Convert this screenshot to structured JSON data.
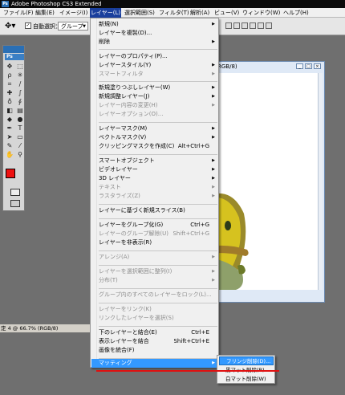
{
  "window": {
    "title": "Adobe Photoshop CS3 Extended"
  },
  "menubar": {
    "items": [
      "ファイル(F)",
      "編集(E)",
      "イメージ(I)",
      "レイヤー(L)",
      "選択範囲(S)",
      "フィルタ(T)",
      "解析(A)",
      "ビュー(V)",
      "ウィンドウ(W)",
      "ヘルプ(H)"
    ],
    "active_index": 3
  },
  "options_bar": {
    "auto_select_label": "自動選択：",
    "auto_select_value": "グループ",
    "auto_select_checked": true
  },
  "toolbox": {
    "logo": "Ps",
    "foreground_color": "#ee1111",
    "background_color": "#ffffff",
    "tools": [
      "move-tool-icon",
      "marquee-tool-icon",
      "lasso-tool-icon",
      "magic-wand-tool-icon",
      "crop-tool-icon",
      "slice-tool-icon",
      "healing-brush-tool-icon",
      "brush-tool-icon",
      "clone-stamp-tool-icon",
      "history-brush-tool-icon",
      "eraser-tool-icon",
      "gradient-tool-icon",
      "blur-tool-icon",
      "dodge-tool-icon",
      "pen-tool-icon",
      "type-tool-icon",
      "path-selection-tool-icon",
      "shape-tool-icon",
      "notes-tool-icon",
      "eyedropper-tool-icon",
      "hand-tool-icon",
      "zoom-tool-icon"
    ]
  },
  "document": {
    "title_fragment": "RGB/8)",
    "left_status": "定 4 @ 66.7% (RGB/8)"
  },
  "layer_menu": {
    "items": [
      {
        "label": "新規(N)",
        "shortcut": "",
        "submenu": true,
        "disabled": false
      },
      {
        "label": "レイヤーを複製(D)...",
        "shortcut": "",
        "submenu": false,
        "disabled": false
      },
      {
        "label": "削除",
        "shortcut": "",
        "submenu": true,
        "disabled": false
      },
      {
        "separator": true
      },
      {
        "label": "レイヤーのプロパティ(P)...",
        "shortcut": "",
        "submenu": false,
        "disabled": false
      },
      {
        "label": "レイヤースタイル(Y)",
        "shortcut": "",
        "submenu": true,
        "disabled": false
      },
      {
        "label": "スマートフィルタ",
        "shortcut": "",
        "submenu": true,
        "disabled": true
      },
      {
        "separator": true
      },
      {
        "label": "新規塗りつぶしレイヤー(W)",
        "shortcut": "",
        "submenu": true,
        "disabled": false
      },
      {
        "label": "新規調整レイヤー(J)",
        "shortcut": "",
        "submenu": true,
        "disabled": false
      },
      {
        "label": "レイヤー内容の変更(H)",
        "shortcut": "",
        "submenu": true,
        "disabled": true
      },
      {
        "label": "レイヤーオプション(O)...",
        "shortcut": "",
        "submenu": false,
        "disabled": true
      },
      {
        "separator": true
      },
      {
        "label": "レイヤーマスク(M)",
        "shortcut": "",
        "submenu": true,
        "disabled": false
      },
      {
        "label": "ベクトルマスク(V)",
        "shortcut": "",
        "submenu": true,
        "disabled": false
      },
      {
        "label": "クリッピングマスクを作成(C)",
        "shortcut": "Alt+Ctrl+G",
        "submenu": false,
        "disabled": false
      },
      {
        "separator": true
      },
      {
        "label": "スマートオブジェクト",
        "shortcut": "",
        "submenu": true,
        "disabled": false
      },
      {
        "label": "ビデオレイヤー",
        "shortcut": "",
        "submenu": true,
        "disabled": false
      },
      {
        "label": "3D レイヤー",
        "shortcut": "",
        "submenu": true,
        "disabled": false
      },
      {
        "label": "テキスト",
        "shortcut": "",
        "submenu": true,
        "disabled": true
      },
      {
        "label": "ラスタライズ(Z)",
        "shortcut": "",
        "submenu": true,
        "disabled": true
      },
      {
        "separator": true
      },
      {
        "label": "レイヤーに基づく新規スライス(B)",
        "shortcut": "",
        "submenu": false,
        "disabled": false
      },
      {
        "separator": true
      },
      {
        "label": "レイヤーをグループ化(G)",
        "shortcut": "Ctrl+G",
        "submenu": false,
        "disabled": false
      },
      {
        "label": "レイヤーのグループ解除(U)",
        "shortcut": "Shift+Ctrl+G",
        "submenu": false,
        "disabled": true
      },
      {
        "label": "レイヤーを非表示(R)",
        "shortcut": "",
        "submenu": false,
        "disabled": false
      },
      {
        "separator": true
      },
      {
        "label": "アレンジ(A)",
        "shortcut": "",
        "submenu": true,
        "disabled": true
      },
      {
        "separator": true
      },
      {
        "label": "レイヤーを選択範囲に整列(I)",
        "shortcut": "",
        "submenu": true,
        "disabled": true
      },
      {
        "label": "分布(T)",
        "shortcut": "",
        "submenu": true,
        "disabled": true
      },
      {
        "separator": true
      },
      {
        "label": "グループ内のすべてのレイヤーをロック(L)...",
        "shortcut": "",
        "submenu": false,
        "disabled": true
      },
      {
        "separator": true
      },
      {
        "label": "レイヤーをリンク(K)",
        "shortcut": "",
        "submenu": false,
        "disabled": true
      },
      {
        "label": "リンクしたレイヤーを選択(S)",
        "shortcut": "",
        "submenu": false,
        "disabled": true
      },
      {
        "separator": true
      },
      {
        "label": "下のレイヤーと結合(E)",
        "shortcut": "Ctrl+E",
        "submenu": false,
        "disabled": false
      },
      {
        "label": "表示レイヤーを結合",
        "shortcut": "Shift+Ctrl+E",
        "submenu": false,
        "disabled": false
      },
      {
        "label": "画像を統合(F)",
        "shortcut": "",
        "submenu": false,
        "disabled": false
      },
      {
        "separator": true
      },
      {
        "label": "マッティング",
        "shortcut": "",
        "submenu": true,
        "disabled": false,
        "highlighted": true
      }
    ]
  },
  "matting_submenu": {
    "items": [
      {
        "label": "フリンジ削除(D)...",
        "highlighted": true
      },
      {
        "label": "黒マット削除(B)",
        "highlighted": false
      },
      {
        "label": "白マット削除(W)",
        "highlighted": false
      }
    ]
  },
  "annotation": {
    "underline_color": "#e01010"
  }
}
